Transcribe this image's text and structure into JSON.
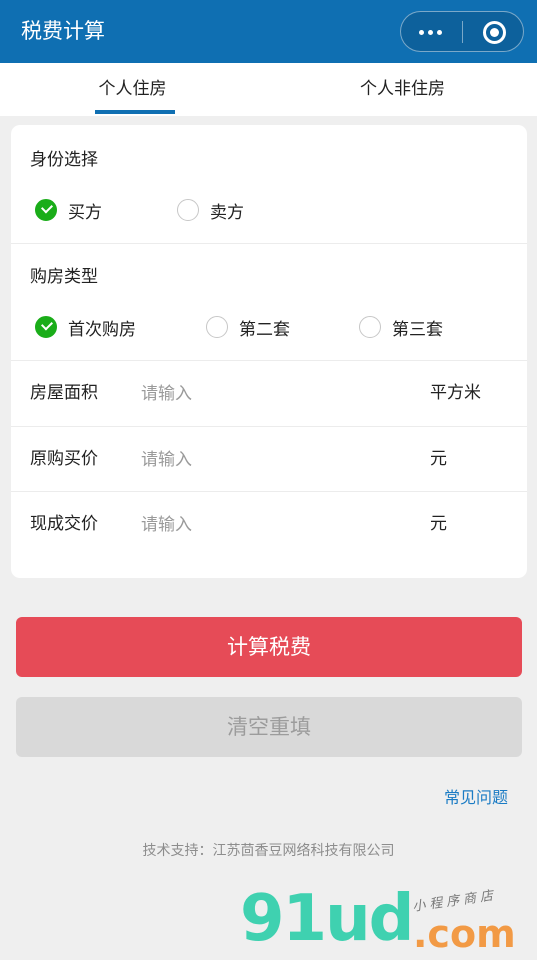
{
  "navbar": {
    "title": "税费计算",
    "more_icon": "more-dots-icon",
    "close_icon": "target-close-icon",
    "background": "#0f6fb2"
  },
  "tabs": [
    {
      "label": "个人住房",
      "active": true
    },
    {
      "label": "个人非住房",
      "active": false
    }
  ],
  "identity": {
    "label": "身份选择",
    "options": [
      {
        "label": "买方",
        "selected": true
      },
      {
        "label": "卖方",
        "selected": false
      }
    ]
  },
  "purchase_type": {
    "label": "购房类型",
    "options": [
      {
        "label": "首次购房",
        "selected": true
      },
      {
        "label": "第二套",
        "selected": false
      },
      {
        "label": "第三套",
        "selected": false
      }
    ]
  },
  "fields": [
    {
      "label": "房屋面积",
      "placeholder": "请输入",
      "unit": "平方米"
    },
    {
      "label": "原购买价",
      "placeholder": "请输入",
      "unit": "元"
    },
    {
      "label": "现成交价",
      "placeholder": "请输入",
      "unit": "元"
    }
  ],
  "buttons": {
    "calculate": "计算税费",
    "clear": "清空重填"
  },
  "faq_link": "常见问题",
  "footer": "技术支持：江苏茴香豆网络科技有限公司",
  "watermark": {
    "brand": "91ud",
    "suffix": ".com",
    "tagline": "小程序商店"
  },
  "colors": {
    "accent": "#0f6fb2",
    "primary_button": "#e64b57",
    "disabled_button": "#d9d9d9",
    "radio_checked": "#1aad19",
    "link": "#1a7bc4"
  }
}
